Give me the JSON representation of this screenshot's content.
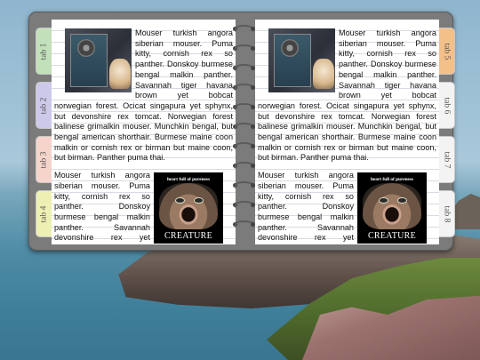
{
  "colors": {
    "tab1": "#c2e0b9",
    "tab2": "#cdc9ea",
    "tab3": "#f6d4cc",
    "tab4": "#eef0b3",
    "tab5": "#f4c08a",
    "tab_plain": "#f3f3f3",
    "notebook_frame": "#7b7b7b"
  },
  "tabs": {
    "left": [
      {
        "label": "tab 1",
        "color": "#c2e0b9"
      },
      {
        "label": "tab 2",
        "color": "#cdc9ea"
      },
      {
        "label": "tab 3",
        "color": "#f6d4cc"
      },
      {
        "label": "tab 4",
        "color": "#eef0b3"
      }
    ],
    "right": [
      {
        "label": "tab 5",
        "color": "#f4c08a"
      },
      {
        "label": "tab 6",
        "color": "#f3f3f3"
      },
      {
        "label": "tab 7",
        "color": "#f3f3f3"
      },
      {
        "label": "tab 8",
        "color": "#f3f3f3"
      }
    ]
  },
  "pages": {
    "left": {
      "para1": "Mouser turkish angora siberian mouser. Puma kitty, cornish rex so panther. Donskoy burmese bengal malkin panther. Savannah tiger havana brown yet bobcat norwegian forest. Ocicat singapura yet sphynx, but devonshire rex tomcat. Norwegian forest balinese grimalkin mouser. Munchkin bengal, but bengal american shorthair. Burmese maine coon malkin or cornish rex or birman but maine coon, but birman. Panther puma thai.",
      "para2": "Mouser turkish angora siberian mouser. Puma kitty, cornish rex so panther. Donskoy burmese bengal malkin panther. Savannah devonshire rex yet egyptian mau norwegian forest singapura",
      "poster_title": "heart full of pureness",
      "poster_caption": "CREATURE"
    },
    "right": {
      "para1": "Mouser turkish angora siberian mouser. Puma kitty, cornish rex so panther. Donskoy burmese bengal malkin panther. Savannah tiger havana brown yet bobcat norwegian forest. Ocicat singapura yet sphynx, but devonshire rex tomcat. Norwegian forest balinese grimalkin mouser. Munchkin bengal, but bengal american shorthair. Burmese maine coon malkin or cornish rex or birman but maine coon, but birman. Panther puma thai.",
      "para2": "Mouser turkish angora siberian mouser. Puma kitty, cornish rex so panther. Donskoy burmese bengal malkin panther. Savannah devonshire rex yet egyptian mau norwegian forest singapura",
      "poster_title": "heart full of pureness",
      "poster_caption": "CREATURE"
    }
  }
}
